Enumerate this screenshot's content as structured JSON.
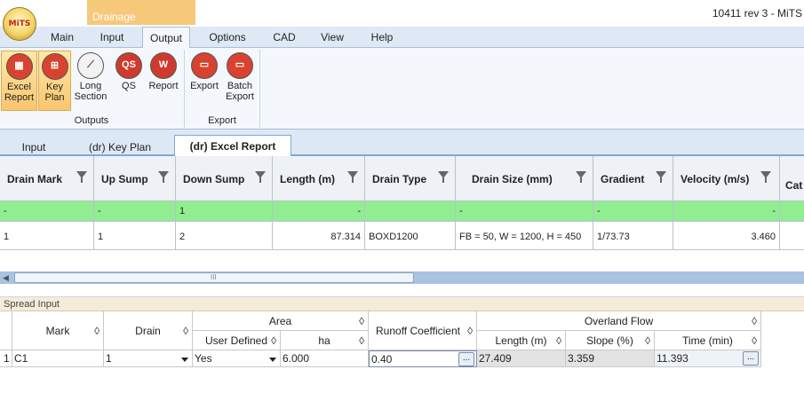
{
  "window": {
    "title": "10411 rev 3 - MiTS",
    "context_tab": "Drainage",
    "logo_text": "MiTS"
  },
  "menu": [
    "Main",
    "Input",
    "Output",
    "Options",
    "CAD",
    "View",
    "Help"
  ],
  "active_menu": "Output",
  "ribbon": {
    "buttons": [
      {
        "label": "Excel Report",
        "lines": [
          "Excel",
          "Report"
        ],
        "icon": "excel-report-icon",
        "selected": true
      },
      {
        "label": "Key Plan",
        "lines": [
          "Key",
          "Plan"
        ],
        "icon": "key-plan-icon",
        "selected": true
      },
      {
        "label": "Long Section",
        "lines": [
          "Long",
          "Section"
        ],
        "icon": "long-section-icon",
        "selected": false
      },
      {
        "label": "QS",
        "lines": [
          "QS",
          ""
        ],
        "icon": "qs-icon",
        "selected": false
      },
      {
        "label": "Report",
        "lines": [
          "Report",
          ""
        ],
        "icon": "report-icon",
        "selected": false
      },
      {
        "label": "Export",
        "lines": [
          "Export",
          ""
        ],
        "icon": "export-icon",
        "selected": false
      },
      {
        "label": "Batch Export",
        "lines": [
          "Batch",
          "Export"
        ],
        "icon": "batch-export-icon",
        "selected": false
      }
    ],
    "groups": [
      "Outputs",
      "Export"
    ]
  },
  "doc_tabs": [
    "Input",
    "(dr) Key Plan",
    "(dr) Excel Report"
  ],
  "active_doc_tab": "(dr) Excel Report",
  "grid": {
    "columns": [
      "Drain Mark",
      "Up Sump",
      "Down Sump",
      "Length (m)",
      "Drain Type",
      "Drain Size (mm)",
      "Gradient",
      "Velocity (m/s)",
      "Cat"
    ],
    "filter_row": [
      "-",
      "-",
      "1",
      "-",
      "",
      "-",
      "-",
      "-",
      ""
    ],
    "rows": [
      [
        "1",
        "1",
        "2",
        "87.314",
        "BOXD1200",
        "FB = 50, W = 1200, H = 450",
        "1/73.73",
        "3.460",
        ""
      ]
    ],
    "scroll_grip": "III",
    "scroll_left": "◀"
  },
  "spread": {
    "title": "Spread Input",
    "headers": {
      "mark": "Mark",
      "drain": "Drain",
      "area": "Area",
      "user_defined": "User Defined",
      "ha": "ha",
      "runoff": "Runoff Coefficient",
      "overland": "Overland Flow",
      "length": "Length (m)",
      "slope": "Slope (%)",
      "time": "Time (min)"
    },
    "sort_glyph": "◊",
    "row": {
      "index": "1",
      "mark": "C1",
      "drain": "1",
      "user_defined": "Yes",
      "ha": "6.000",
      "runoff": "0.40",
      "length": "27.409",
      "slope": "3.359",
      "time": "11.393"
    },
    "ellipsis": "..."
  },
  "colors": {
    "filter_row": "#90ee90",
    "ribbon_selected": "#f9c56e",
    "context_tab": "#f6c87a",
    "accent": "#7fa9d8"
  }
}
